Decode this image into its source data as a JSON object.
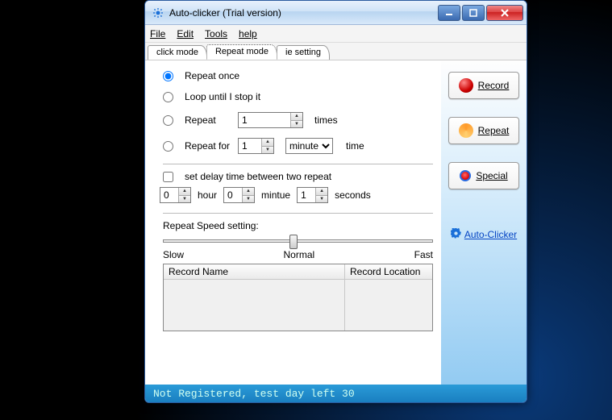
{
  "titlebar": {
    "title": "Auto-clicker (Trial version)"
  },
  "menu": {
    "file": "File",
    "edit": "Edit",
    "tools": "Tools",
    "help": "help"
  },
  "tabs": {
    "click": "click mode",
    "repeat": "Repeat mode",
    "ie": "ie setting"
  },
  "options": {
    "repeat_once": "Repeat once",
    "loop_until": "Loop until I stop it",
    "repeat": "Repeat",
    "repeat_value": "1",
    "repeat_unit": "times",
    "repeat_for": "Repeat for",
    "repeat_for_value": "1",
    "repeat_for_unit": "minute",
    "repeat_for_time": "time",
    "set_delay": "set delay time between two repeat",
    "hour_value": "0",
    "hour_label": "hour",
    "minute_value": "0",
    "minute_label": "mintue",
    "second_value": "1",
    "second_label": "seconds",
    "speed_label": "Repeat Speed setting:",
    "slow": "Slow",
    "normal": "Normal",
    "fast": "Fast"
  },
  "sidebar": {
    "record": "Record",
    "repeat": "Repeat",
    "special": "Special",
    "link": "Auto-Clicker"
  },
  "table": {
    "col1": "Record Name",
    "col2": "Record Location"
  },
  "status": "Not Registered, test day left 30"
}
